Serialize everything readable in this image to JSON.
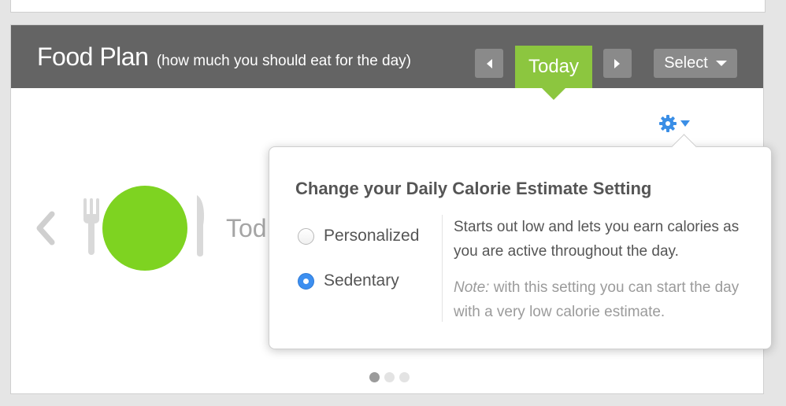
{
  "header": {
    "title": "Food Plan",
    "subtitle": "(how much you should eat for the day)",
    "prev_icon": "chevron-left-icon",
    "next_icon": "chevron-right-icon",
    "today_label": "Today",
    "select_label": "Select"
  },
  "carousel": {
    "partial_label": "Tod",
    "dot_count": 3,
    "active_dot": 0
  },
  "settings": {
    "icon": "gear-icon",
    "popover": {
      "title": "Change your Daily Calorie Estimate Setting",
      "options": [
        {
          "label": "Personalized",
          "selected": false
        },
        {
          "label": "Sedentary",
          "selected": true
        }
      ],
      "description": "Starts out low and lets you earn calories as you are active throughout the day.",
      "note_label": "Note:",
      "note_text": " with this setting you can start the day with a very low calorie estimate."
    }
  },
  "colors": {
    "header_bg": "#646464",
    "accent_green": "#8cc63f",
    "plate_green": "#7ed321",
    "radio_blue": "#3d8ff0"
  }
}
